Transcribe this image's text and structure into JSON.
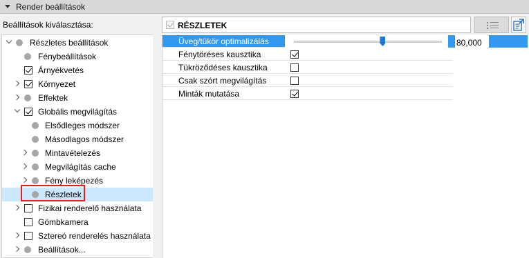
{
  "header": {
    "title": "Render beállítások"
  },
  "selector_label": "Beállítások kiválasztása:",
  "tree": {
    "items": [
      {
        "label": "Részletes beállítások",
        "kind": "dot",
        "expander": "down",
        "level": 0
      },
      {
        "label": "Fénybeállítások",
        "kind": "dot",
        "expander": "none",
        "level": 1
      },
      {
        "label": "Árnyékvetés",
        "kind": "checkbox",
        "checked": true,
        "expander": "none",
        "level": 1
      },
      {
        "label": "Környezet",
        "kind": "checkbox",
        "checked": true,
        "expander": "right",
        "level": 1
      },
      {
        "label": "Effektek",
        "kind": "dot",
        "expander": "right",
        "level": 1
      },
      {
        "label": "Globális megvilágítás",
        "kind": "checkbox",
        "checked": true,
        "expander": "down",
        "level": 1
      },
      {
        "label": "Elsődleges módszer",
        "kind": "dot",
        "expander": "none",
        "level": 2
      },
      {
        "label": "Másodlagos módszer",
        "kind": "dot",
        "expander": "none",
        "level": 2
      },
      {
        "label": "Mintavételezés",
        "kind": "dot",
        "expander": "right",
        "level": 2
      },
      {
        "label": "Megvilágítás cache",
        "kind": "dot",
        "expander": "right",
        "level": 2
      },
      {
        "label": "Fény leképezés",
        "kind": "dot",
        "expander": "right",
        "level": 2
      },
      {
        "label": "Részletek",
        "kind": "dot",
        "expander": "none",
        "level": 2,
        "selected": true
      },
      {
        "label": "Fizikai renderelő használata",
        "kind": "checkbox",
        "checked": false,
        "expander": "right",
        "level": 1
      },
      {
        "label": "Gömbkamera",
        "kind": "checkbox",
        "checked": false,
        "expander": "none",
        "level": 1
      },
      {
        "label": "Sztereó renderelés használata",
        "kind": "checkbox",
        "checked": false,
        "expander": "right",
        "level": 1
      },
      {
        "label": "Beállítások...",
        "kind": "dot",
        "expander": "right",
        "level": 1
      }
    ]
  },
  "section": {
    "title": "RÉSZLETEK",
    "checked": true
  },
  "toolbar": {
    "list_icon": "list-settings-icon",
    "export_icon": "export-icon"
  },
  "rows": [
    {
      "label": "Üveg/tükör optimalizálás",
      "type": "slider",
      "value": "80,000",
      "fraction": 0.6
    },
    {
      "label": "Fénytöréses kausztika",
      "type": "checkbox",
      "checked": true
    },
    {
      "label": "Tükröződéses kausztika",
      "type": "checkbox",
      "checked": false
    },
    {
      "label": "Csak szórt megvilágítás",
      "type": "checkbox",
      "checked": false
    },
    {
      "label": "Minták mutatása",
      "type": "checkbox",
      "checked": true
    }
  ]
}
